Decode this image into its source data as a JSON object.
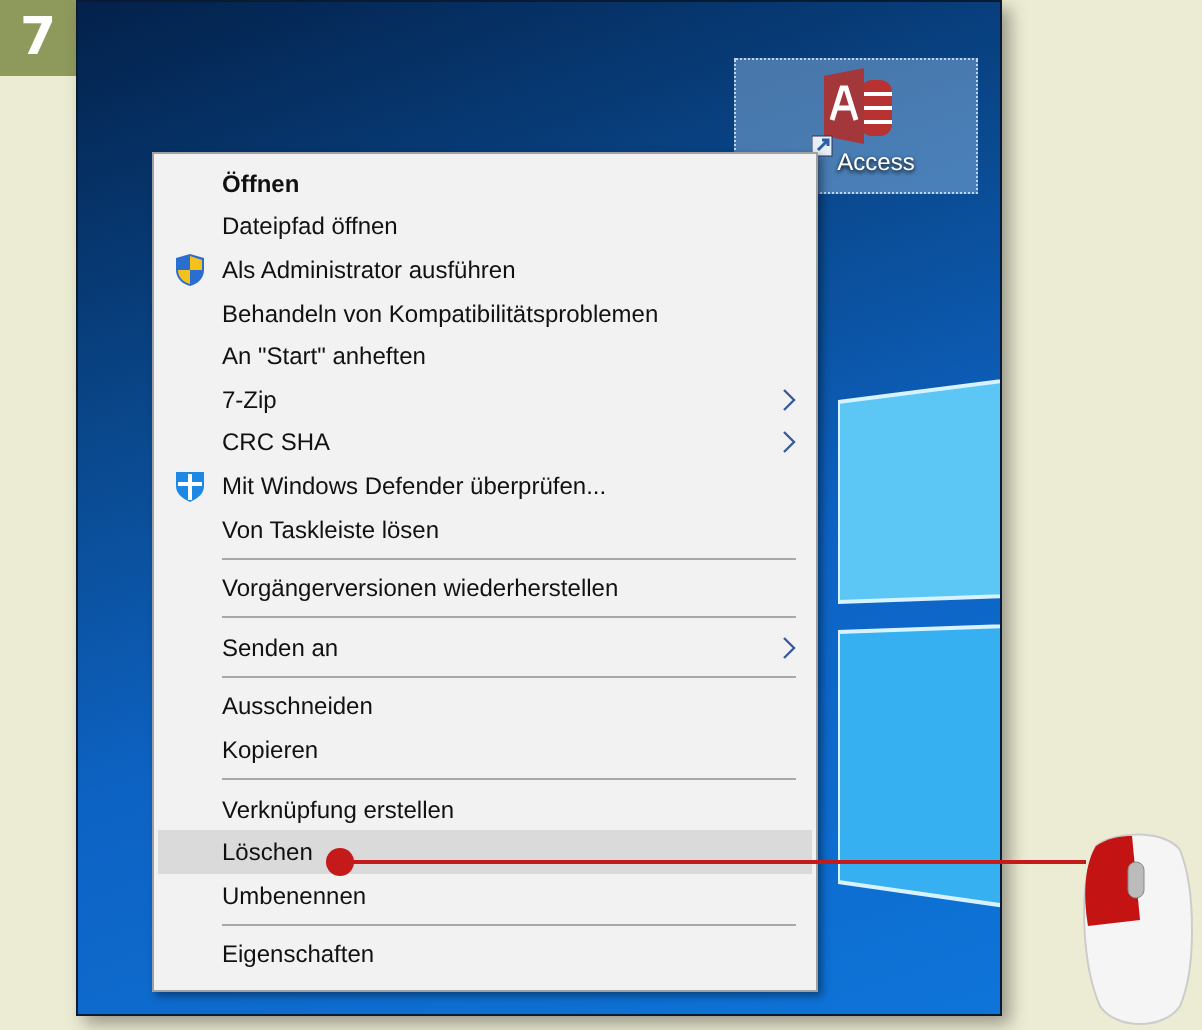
{
  "step_badge": "7",
  "desktop_icon": {
    "label": "Access",
    "selected": true
  },
  "context_menu": {
    "items": [
      {
        "kind": "item",
        "label": "Öffnen",
        "default": true,
        "submenu": false,
        "selected": false
      },
      {
        "kind": "item",
        "label": "Dateipfad öffnen",
        "default": false,
        "submenu": false,
        "selected": false
      },
      {
        "kind": "uac_item",
        "label": "Als Administrator ausführen",
        "default": false,
        "submenu": false,
        "selected": false
      },
      {
        "kind": "item",
        "label": "Behandeln von Kompatibilitätsproblemen",
        "default": false,
        "submenu": false,
        "selected": false
      },
      {
        "kind": "item",
        "label": "An \"Start\" anheften",
        "default": false,
        "submenu": false,
        "selected": false
      },
      {
        "kind": "item",
        "label": "7-Zip",
        "default": false,
        "submenu": true,
        "selected": false
      },
      {
        "kind": "item",
        "label": "CRC SHA",
        "default": false,
        "submenu": true,
        "selected": false
      },
      {
        "kind": "defender_item",
        "label": "Mit Windows Defender überprüfen...",
        "default": false,
        "submenu": false,
        "selected": false
      },
      {
        "kind": "item",
        "label": "Von Taskleiste lösen",
        "default": false,
        "submenu": false,
        "selected": false
      },
      {
        "kind": "separator"
      },
      {
        "kind": "item",
        "label": "Vorgängerversionen wiederherstellen",
        "default": false,
        "submenu": false,
        "selected": false
      },
      {
        "kind": "separator"
      },
      {
        "kind": "item",
        "label": "Senden an",
        "default": false,
        "submenu": true,
        "selected": false
      },
      {
        "kind": "separator"
      },
      {
        "kind": "item",
        "label": "Ausschneiden",
        "default": false,
        "submenu": false,
        "selected": false
      },
      {
        "kind": "item",
        "label": "Kopieren",
        "default": false,
        "submenu": false,
        "selected": false
      },
      {
        "kind": "separator"
      },
      {
        "kind": "item",
        "label": "Verknüpfung erstellen",
        "default": false,
        "submenu": false,
        "selected": false
      },
      {
        "kind": "item",
        "label": "Löschen",
        "default": false,
        "submenu": false,
        "selected": true
      },
      {
        "kind": "item",
        "label": "Umbenennen",
        "default": false,
        "submenu": false,
        "selected": false
      },
      {
        "kind": "separator"
      },
      {
        "kind": "item",
        "label": "Eigenschaften",
        "default": false,
        "submenu": false,
        "selected": false
      }
    ]
  }
}
